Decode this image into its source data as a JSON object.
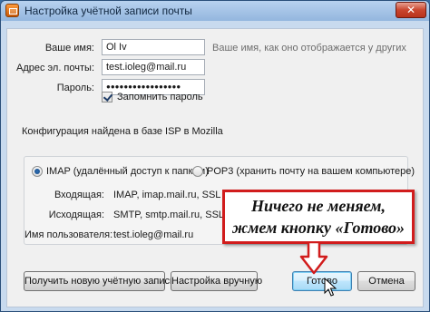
{
  "window": {
    "title": "Настройка учётной записи почты",
    "close_label": "✕"
  },
  "form": {
    "name_label": "Ваше имя:",
    "name_value": "Ol Iv",
    "name_hint": "Ваше имя, как оно отображается у других",
    "email_label": "Адрес эл. почты:",
    "email_value": "test.ioleg@mail.ru",
    "password_label": "Пароль:",
    "password_value": "●●●●●●●●●●●●●●●●●",
    "remember_label": "Запомнить пароль",
    "remember_checked": true
  },
  "config_found": "Конфигурация найдена в базе ISP в Mozilla",
  "protocol": {
    "imap_label": "IMAP (удалённый доступ к папкам)",
    "pop3_label": "POP3 (хранить почту на вашем компьютере)",
    "selected": "imap"
  },
  "servers": {
    "incoming_label": "Входящая:",
    "incoming_value": "IMAP, imap.mail.ru, SSL",
    "outgoing_label": "Исходящая:",
    "outgoing_value": "SMTP, smtp.mail.ru, SSL",
    "username_label": "Имя пользователя:",
    "username_value": "test.ioleg@mail.ru"
  },
  "buttons": {
    "get_new": "Получить новую учётную запись",
    "manual": "Настройка вручную",
    "done": "Готово",
    "cancel": "Отмена"
  },
  "annotation": {
    "line1": "Ничего не меняем,",
    "line2": "жмем кнопку «Готово»",
    "color": "#d11c1c"
  },
  "colors": {
    "titlebar": "#a9c6e6",
    "dialog_bg": "#f0f0f0",
    "default_button": "#bee6fd"
  }
}
